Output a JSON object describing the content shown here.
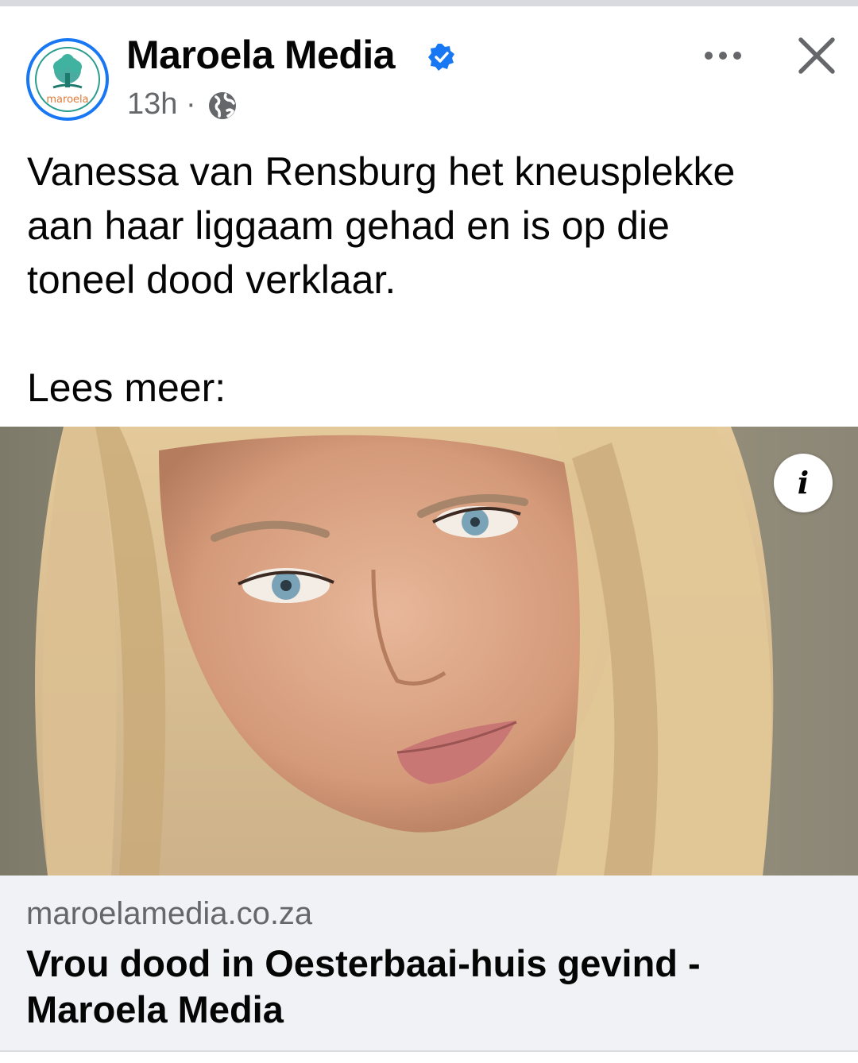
{
  "post": {
    "page_name": "Maroela Media",
    "avatar_logo_text": "maroela",
    "time": "13h",
    "separator": "·",
    "caption_lines": [
      "Vanessa van Rensburg het kneusplekke",
      "aan haar liggaam gehad en is op die",
      "toneel dood verklaar."
    ],
    "read_more": "Lees meer:"
  },
  "icons": {
    "verified": "verified-badge-icon",
    "privacy": "globe-icon",
    "more": "more-options-icon",
    "close": "close-icon",
    "info": "info-icon"
  },
  "info_glyph": "i",
  "link_preview": {
    "domain": "maroelamedia.co.za",
    "title": "Vrou dood in Oesterbaai-huis gevind - Maroela Media"
  },
  "colors": {
    "accent": "#1877f2",
    "text_primary": "#050505",
    "text_secondary": "#65676b",
    "link_bg": "#f0f2f5"
  }
}
